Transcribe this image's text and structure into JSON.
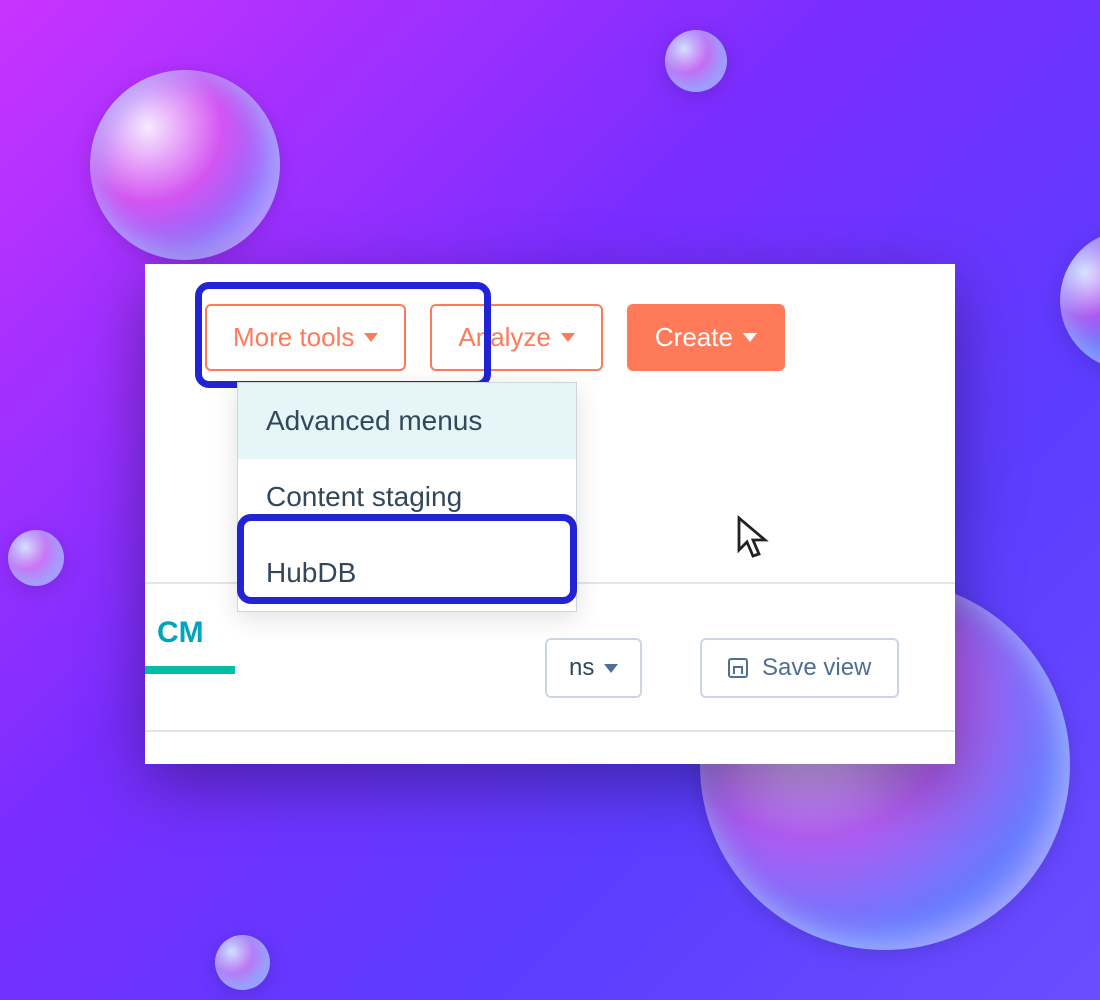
{
  "toolbar": {
    "more_tools_label": "More tools",
    "analyze_label": "Analyze",
    "create_label": "Create"
  },
  "dropdown": {
    "items": [
      {
        "label": "Advanced menus"
      },
      {
        "label": "Content staging"
      },
      {
        "label": "HubDB"
      }
    ]
  },
  "lower": {
    "tab_cms_fragment": "CM",
    "truncated_button_fragment": "ns",
    "save_view_label": "Save view"
  },
  "colors": {
    "accent_orange": "#ff7a59",
    "highlight_blue": "#2323d6",
    "teal": "#00a4bd",
    "teal_underline": "#00bda5"
  }
}
